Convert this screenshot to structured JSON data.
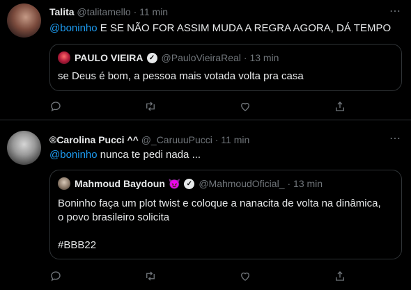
{
  "tweets": [
    {
      "name": "Talita",
      "handle": "@talitamello",
      "time": "· 11 min",
      "mention": "@boninho",
      "text": " E SE NÃO FOR ASSIM MUDA A REGRA AGORA, DÁ TEMPO",
      "quote": {
        "name": "PAULO VIEIRA",
        "handle": "@PauloVieiraReal",
        "time": "· 13 min",
        "lines": [
          "se Deus é bom, a pessoa mais votada volta pra casa"
        ]
      }
    },
    {
      "name": "®Carolina Pucci ^^",
      "handle": "@_CaruuuPucci",
      "time": "· 11 min",
      "mention": "@boninho",
      "text": " nunca te pedi nada ...",
      "quote": {
        "name": "Mahmoud Baydoun",
        "emoji": "😈",
        "handle": "@MahmoudOficial_",
        "time": "· 13 min",
        "lines": [
          "Boninho faça um plot twist e coloque a nanacita de volta na dinâmica,",
          "o povo brasileiro solicita",
          "#BBB22"
        ]
      }
    }
  ],
  "colors": {
    "background": "#000000",
    "text": "#e7e9ea",
    "muted": "#71767b",
    "mention": "#1d9bf0",
    "border": "#2f3336"
  },
  "icons": [
    "reply-icon",
    "retweet-icon",
    "like-icon",
    "share-icon",
    "more-icon",
    "verified-icon"
  ]
}
